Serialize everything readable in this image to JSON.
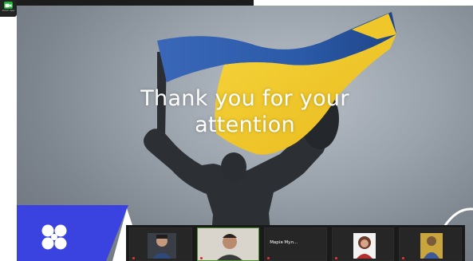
{
  "window": {
    "app_chip_label": "Zoom App"
  },
  "slide": {
    "title_line1": "Thank you for your",
    "title_line2": "attention"
  },
  "colors": {
    "brand_blue": "#3a43e0",
    "flag_blue": "#2f5fb0",
    "flag_yellow": "#f3cf2e",
    "zoom_green": "#1fb33a"
  },
  "participants": [
    {
      "name": "",
      "type": "video"
    },
    {
      "name": "",
      "type": "video",
      "active": true
    },
    {
      "name": "Марія Мул...",
      "type": "text"
    },
    {
      "name": "",
      "type": "video"
    },
    {
      "name": "",
      "type": "video"
    }
  ]
}
